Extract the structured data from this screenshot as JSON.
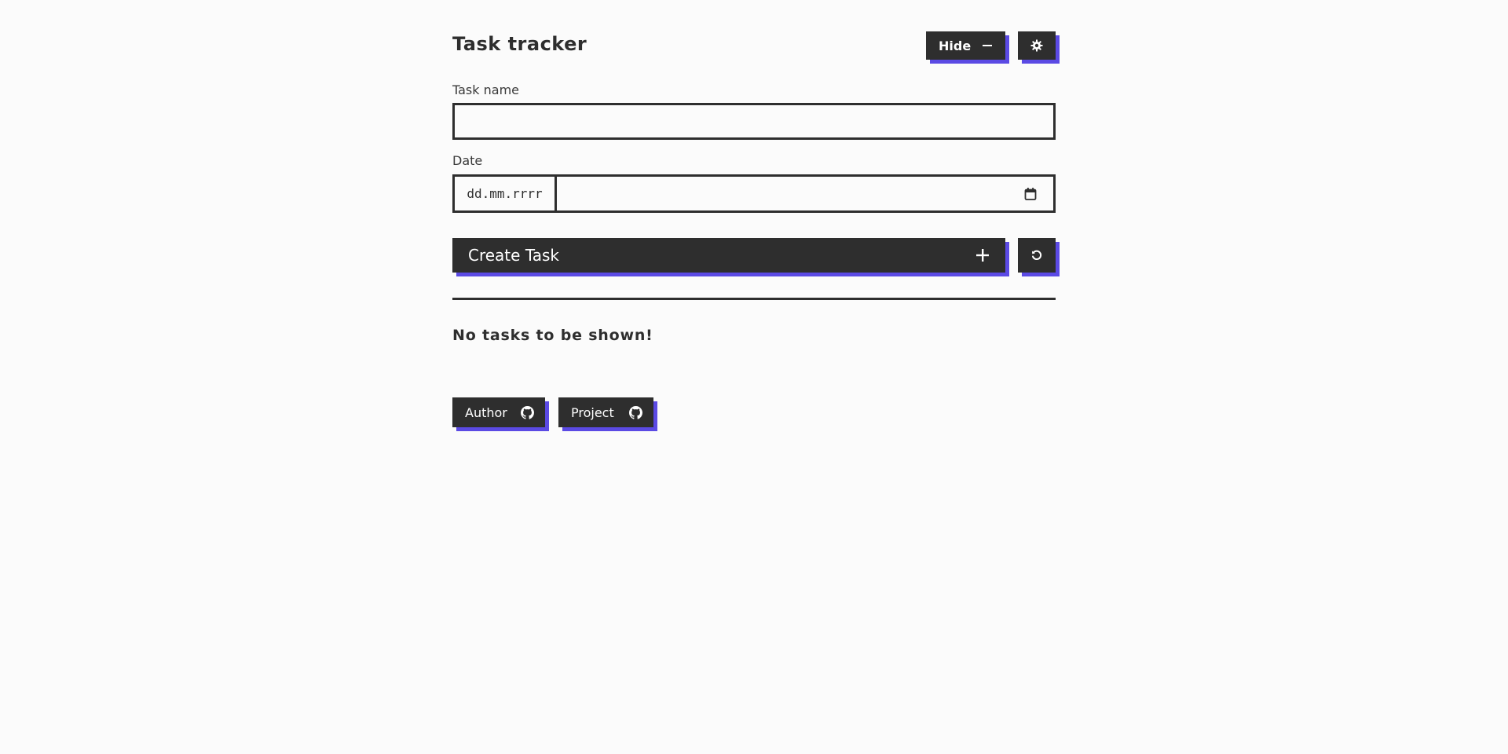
{
  "header": {
    "title": "Task tracker",
    "hide_label": "Hide",
    "hide_icon": "minus-icon",
    "settings_icon": "gear-icon"
  },
  "form": {
    "task_name_label": "Task name",
    "task_name_value": "",
    "date_label": "Date",
    "date_placeholder": "dd.mm.rrrr",
    "calendar_icon": "calendar-icon",
    "create_label": "Create Task",
    "create_icon": "plus-icon",
    "reset_icon": "undo-icon"
  },
  "tasks": {
    "empty_message": "No tasks to be shown!"
  },
  "footer": {
    "author_label": "Author",
    "project_label": "Project",
    "link_icon": "github-icon"
  },
  "colors": {
    "background": "#fbfbfb",
    "primary": "#2e2e2e",
    "accent_shadow": "#5b4ae4",
    "button_text": "#ffffff"
  }
}
